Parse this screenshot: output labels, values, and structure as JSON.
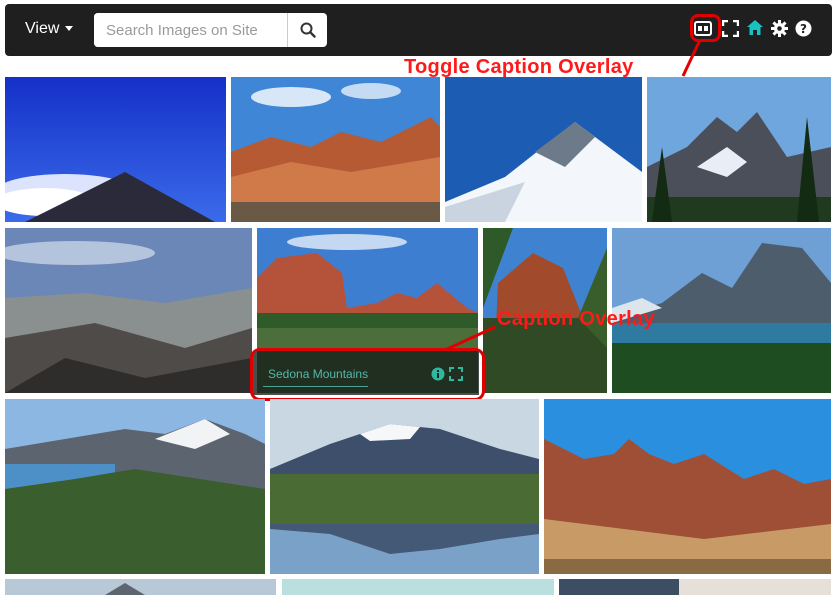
{
  "toolbar": {
    "view_label": "View",
    "search_placeholder": "Search Images on Site",
    "icons": [
      "caption-toggle-icon",
      "fullscreen-icon",
      "home-icon",
      "settings-icon",
      "help-icon"
    ],
    "home_icon_color": "#19c2c2"
  },
  "annotations": {
    "toggle_caption": "Toggle Caption Overlay",
    "caption_overlay": "Caption Overlay"
  },
  "caption_overlay": {
    "title": "Sedona Mountains",
    "icons": [
      "info-icon",
      "expand-icon"
    ],
    "accent": "#2fb7a0"
  },
  "gallery": {
    "images": [
      "blue-sky-peak",
      "red-rock-canyon",
      "snowy-peak",
      "alpine-range",
      "barren-valley",
      "sedona-mountains",
      "zion-cliffs",
      "glacier-lake",
      "green-ridge",
      "snow-volcano-reflection",
      "red-desert-peaks",
      "bottom-row-1",
      "bottom-row-2",
      "bottom-row-3"
    ]
  }
}
